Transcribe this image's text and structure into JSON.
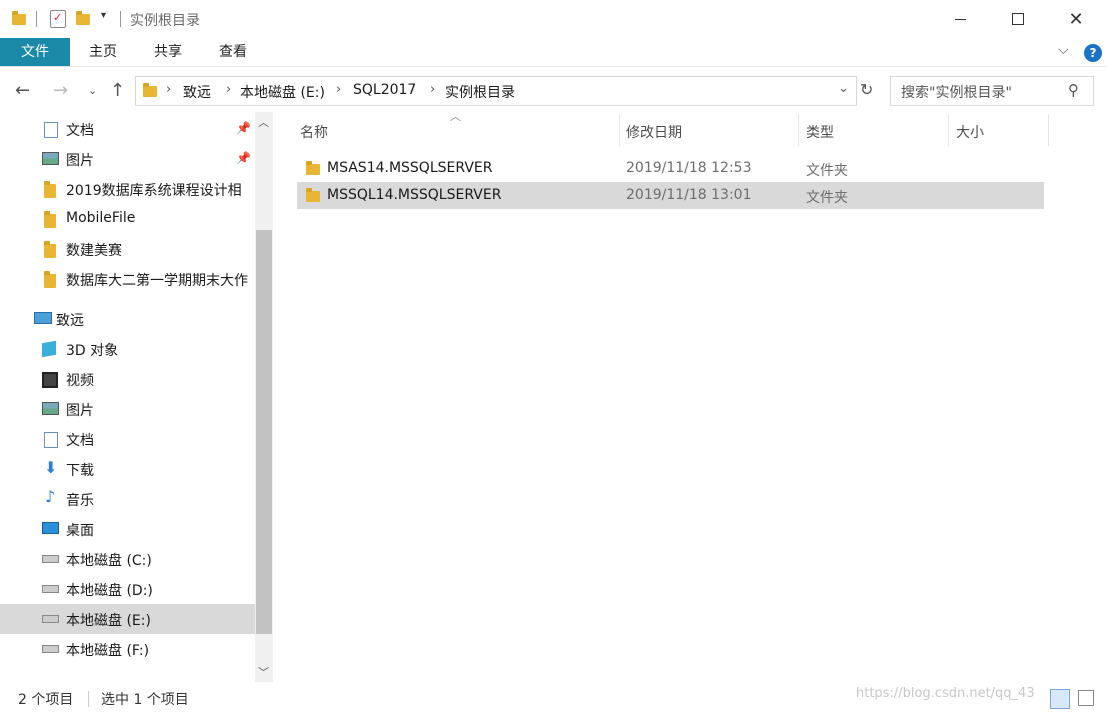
{
  "window": {
    "title": "实例根目录"
  },
  "ribbon": {
    "tabs": [
      "文件",
      "主页",
      "共享",
      "查看"
    ]
  },
  "address": {
    "crumbs": [
      "致远",
      "本地磁盘 (E:)",
      "SQL2017",
      "实例根目录"
    ],
    "search_placeholder": "搜索\"实例根目录\""
  },
  "sidebar": {
    "items": [
      {
        "label": "文档",
        "icon": "document-icon",
        "pinned": true
      },
      {
        "label": "图片",
        "icon": "picture-icon",
        "pinned": true
      },
      {
        "label": "2019数据库系统课程设计相",
        "icon": "folder-icon"
      },
      {
        "label": "MobileFile",
        "icon": "folder-icon"
      },
      {
        "label": "数建美赛",
        "icon": "folder-icon"
      },
      {
        "label": "数据库大二第一学期期末大作",
        "icon": "folder-icon"
      },
      {
        "label": "致远",
        "icon": "computer-icon"
      },
      {
        "label": "3D 对象",
        "icon": "3d-objects-icon"
      },
      {
        "label": "视频",
        "icon": "video-icon"
      },
      {
        "label": "图片",
        "icon": "picture-icon"
      },
      {
        "label": "文档",
        "icon": "document-icon"
      },
      {
        "label": "下载",
        "icon": "download-icon"
      },
      {
        "label": "音乐",
        "icon": "music-icon"
      },
      {
        "label": "桌面",
        "icon": "desktop-icon"
      },
      {
        "label": "本地磁盘 (C:)",
        "icon": "system-drive-icon"
      },
      {
        "label": "本地磁盘 (D:)",
        "icon": "drive-icon"
      },
      {
        "label": "本地磁盘 (E:)",
        "icon": "drive-icon",
        "selected": true
      },
      {
        "label": "本地磁盘 (F:)",
        "icon": "drive-icon"
      }
    ]
  },
  "columns": [
    "名称",
    "修改日期",
    "类型",
    "大小"
  ],
  "files": [
    {
      "name": "MSAS14.MSSQLSERVER",
      "date": "2019/11/18 12:53",
      "type": "文件夹",
      "size": ""
    },
    {
      "name": "MSSQL14.MSSQLSERVER",
      "date": "2019/11/18 13:01",
      "type": "文件夹",
      "size": "",
      "selected": true
    }
  ],
  "status": {
    "count": "2 个项目",
    "selection": "选中 1 个项目"
  },
  "watermark": "https://blog.csdn.net/qq_43"
}
